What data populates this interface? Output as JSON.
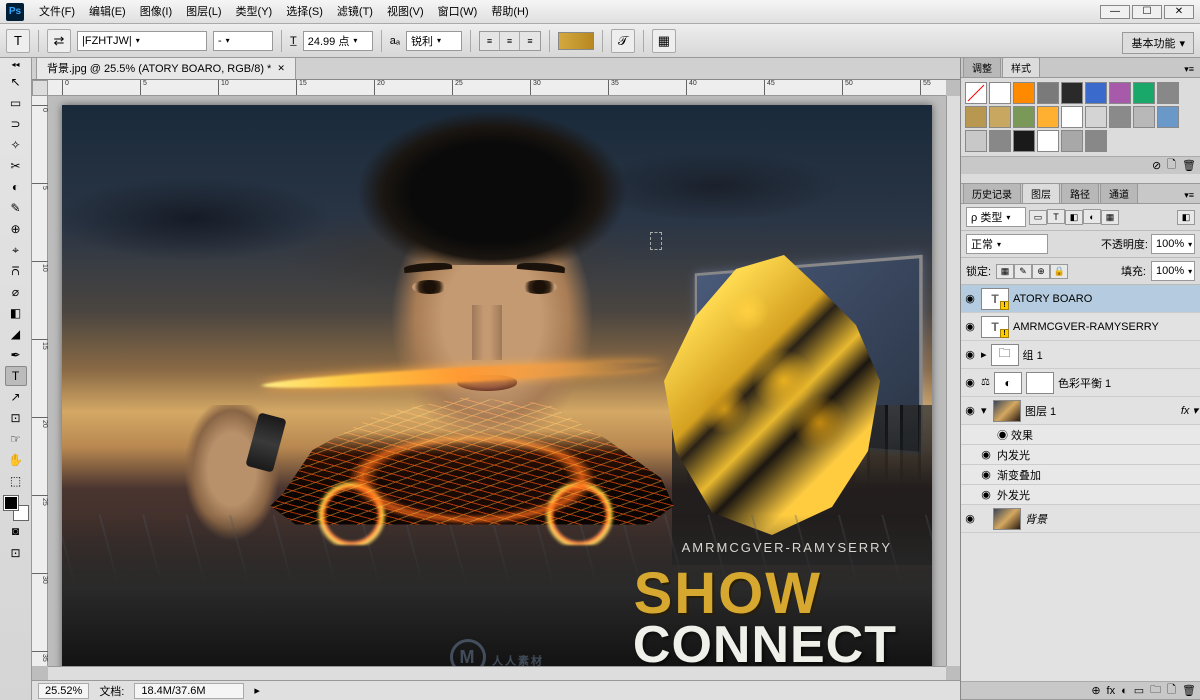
{
  "app": {
    "logo": "Ps"
  },
  "menu": [
    "文件(F)",
    "编辑(E)",
    "图像(I)",
    "图层(L)",
    "类型(Y)",
    "选择(S)",
    "滤镜(T)",
    "视图(V)",
    "窗口(W)",
    "帮助(H)"
  ],
  "workspace": "基本功能",
  "options": {
    "tool_glyph": "T",
    "toggle_glyph": "⇄",
    "font_family": "|FZHTJW|",
    "font_style": "-",
    "size_glyph": "T̲",
    "font_size": "24.99 点",
    "aa_glyph": "aₐ",
    "aa": "锐利",
    "align": [
      "≡",
      "≡",
      "≡"
    ],
    "warp_glyph": "𝒯",
    "panel_glyph": "▦"
  },
  "doc_tab": "背景.jpg @ 25.5% (ATORY BOARO, RGB/8) *",
  "ruler_h": [
    "0",
    "5",
    "10",
    "15",
    "20",
    "25",
    "30",
    "35",
    "40",
    "45",
    "50",
    "55"
  ],
  "ruler_v": [
    "0",
    "5",
    "10",
    "15",
    "20",
    "25",
    "30",
    "35"
  ],
  "toolbox_tools": [
    "↖",
    "▭",
    "⊃",
    "✧",
    "✂",
    "◐",
    "✎",
    "⊕",
    "⌖",
    "⩃",
    "⌀",
    "◧",
    "◢",
    "✒",
    "T",
    "↗",
    "⊡",
    "☞",
    "✋",
    "⬚"
  ],
  "selected_tool_index": 14,
  "canvas": {
    "txt_amr": "AMRMCGVER-RAMYSERRY",
    "txt_show": "SHOW",
    "txt_connect": "CONNECT",
    "txt_atory": "ATORY BOARO",
    "wm_inner": "M",
    "wm_text": "人人素材"
  },
  "status": {
    "zoom": "25.52%",
    "doc_label": "文档:",
    "doc_info": "18.4M/37.6M"
  },
  "panels": {
    "adj_tabs": [
      "调整",
      "样式"
    ],
    "swatches": [
      [
        "#ffffff",
        "#ff8a00",
        "#7a7a7a",
        "#2a2a2a",
        "#3a6acc",
        "#a85aaa",
        "#1aa86a",
        "#888888"
      ],
      [
        "#b89850",
        "#c8a860",
        "#7a9858",
        "#ffb030",
        "#ffffff",
        "#d4d4d4",
        "#8a8a8a",
        "#b8b8b8"
      ],
      [
        "#6a98c8",
        "#c8c8c8",
        "#888888",
        "#1a1a1a",
        "#ffffff",
        "#a8a8a8",
        "#888888"
      ]
    ],
    "swatch_none": "⊘",
    "hist_tabs": [
      "历史记录",
      "图层",
      "路径",
      "通道"
    ],
    "hist_active": 1,
    "filter": {
      "label": "ρ 类型",
      "icons": [
        "▭",
        "T",
        "◧",
        "◐",
        "▦"
      ]
    },
    "blend": {
      "mode": "正常",
      "opacity_lbl": "不透明度:",
      "opacity": "100%"
    },
    "lock": {
      "label": "锁定:",
      "icons": [
        "▦",
        "✎",
        "⊕",
        "🔒"
      ],
      "fill_lbl": "填充:",
      "fill": "100%"
    },
    "layers": [
      {
        "eye": "◉",
        "type": "text",
        "warn": true,
        "name": "ATORY BOARO",
        "sel": true
      },
      {
        "eye": "◉",
        "type": "text",
        "warn": true,
        "name": "AMRMCGVER-RAMYSERRY"
      },
      {
        "eye": "◉",
        "type": "group",
        "name": "组 1"
      },
      {
        "eye": "◉",
        "type": "adj",
        "name": "色彩平衡 1",
        "link": true
      },
      {
        "eye": "◉",
        "type": "img",
        "name": "图层 1",
        "fx": "fx"
      },
      {
        "sub": true,
        "eye": "",
        "name": "◉ 效果"
      },
      {
        "sub": true,
        "eye": "◉",
        "name": "内发光"
      },
      {
        "sub": true,
        "eye": "◉",
        "name": "渐变叠加"
      },
      {
        "sub": true,
        "eye": "◉",
        "name": "外发光"
      },
      {
        "eye": "◉",
        "type": "bg",
        "name": "背景",
        "italic": true
      }
    ],
    "layer_btm": [
      "⊕",
      "fx",
      "◐",
      "▭",
      "🗀",
      "🗋",
      "🗑"
    ]
  }
}
